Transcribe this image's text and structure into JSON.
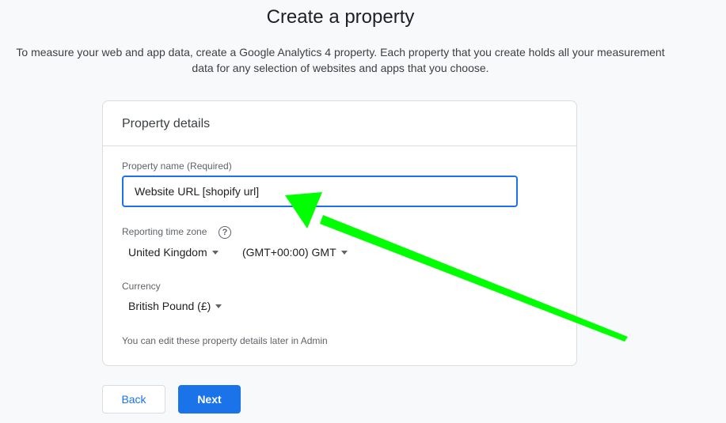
{
  "page": {
    "title": "Create a property",
    "description": "To measure your web and app data, create a Google Analytics 4 property. Each property that you create holds all your measurement data for any selection of websites and apps that you choose."
  },
  "card": {
    "header": "Property details",
    "property_name": {
      "label": "Property name (Required)",
      "value": "Website URL [shopify url]"
    },
    "timezone": {
      "label": "Reporting time zone",
      "country": "United Kingdom",
      "zone": "(GMT+00:00) GMT"
    },
    "currency": {
      "label": "Currency",
      "value": "British Pound (£)"
    },
    "note": "You can edit these property details later in Admin"
  },
  "buttons": {
    "back": "Back",
    "next": "Next"
  },
  "colors": {
    "accent": "#1a73e8",
    "annotation_arrow": "#00ff00"
  },
  "icons": {
    "help": "help-circle-icon",
    "dropdown": "caret-down-icon"
  }
}
